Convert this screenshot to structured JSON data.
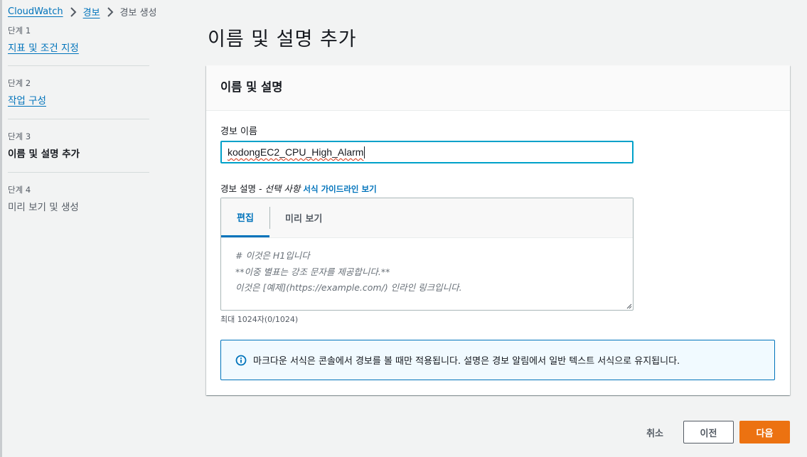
{
  "breadcrumb": {
    "items": [
      "CloudWatch",
      "경보"
    ],
    "current": "경보 생성"
  },
  "steps": [
    {
      "num": "단계 1",
      "title": "지표 및 조건 지정",
      "state": "link"
    },
    {
      "num": "단계 2",
      "title": "작업 구성",
      "state": "link"
    },
    {
      "num": "단계 3",
      "title": "이름 및 설명 추가",
      "state": "current"
    },
    {
      "num": "단계 4",
      "title": "미리 보기 및 생성",
      "state": "disabled"
    }
  ],
  "page_title": "이름 및 설명 추가",
  "section": {
    "title": "이름 및 설명",
    "name_label": "경보 이름",
    "name_value": "kodongEC2_CPU_High_Alarm",
    "desc_label": "경보 설명 - ",
    "desc_optional": "선택 사항",
    "desc_guide_link": "서식 가이드라인 보기",
    "tabs": {
      "edit": "편집",
      "preview": "미리 보기"
    },
    "placeholder_lines": [
      "# 이것은 H1입니다",
      "**이중 별표는 강조 문자를 제공합니다.**",
      "이것은 [예제](https://example.com/) 인라인 링크입니다."
    ],
    "char_count": "최대 1024자(0/1024)",
    "info_text": "마크다운 서식은 콘솔에서 경보를 볼 때만 적용됩니다. 설명은 경보 알림에서 일반 텍스트 서식으로 유지됩니다."
  },
  "footer": {
    "cancel": "취소",
    "previous": "이전",
    "next": "다음"
  },
  "colors": {
    "link": "#0073bb",
    "primary_button": "#ec7211",
    "focus_border": "#00a1c9",
    "info_bg": "#f1faff"
  },
  "icons": [
    "chevron-right-icon",
    "info-icon"
  ]
}
